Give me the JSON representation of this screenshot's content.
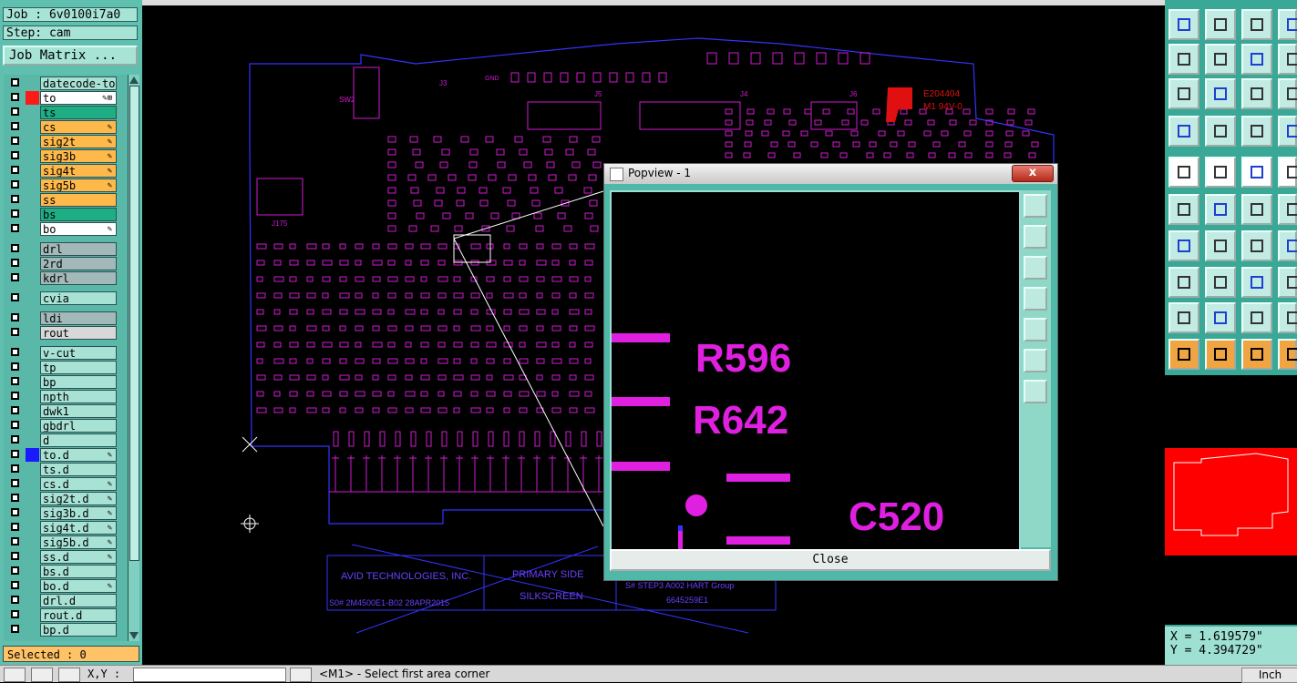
{
  "job": {
    "job_label": "Job : 6v0100i7a0",
    "step_label": "Step: cam",
    "matrix_button": "Job Matrix ..."
  },
  "layers": [
    {
      "name": "datecode-to",
      "color": "#a8e2d4",
      "swatch": "",
      "edit": ""
    },
    {
      "name": "to",
      "color": "#ffffff",
      "swatch": "#ff1a1a",
      "edit": "✎⊞"
    },
    {
      "name": "ts",
      "color": "#1fae83",
      "swatch": "",
      "edit": ""
    },
    {
      "name": "cs",
      "color": "#ffb94a",
      "swatch": "",
      "edit": "✎"
    },
    {
      "name": "sig2t",
      "color": "#ffb94a",
      "swatch": "",
      "edit": "✎"
    },
    {
      "name": "sig3b",
      "color": "#ffb94a",
      "swatch": "",
      "edit": "✎"
    },
    {
      "name": "sig4t",
      "color": "#ffb94a",
      "swatch": "",
      "edit": "✎"
    },
    {
      "name": "sig5b",
      "color": "#ffb94a",
      "swatch": "",
      "edit": "✎"
    },
    {
      "name": "ss",
      "color": "#ffb94a",
      "swatch": "",
      "edit": ""
    },
    {
      "name": "bs",
      "color": "#1fae83",
      "swatch": "",
      "edit": ""
    },
    {
      "name": "bo",
      "color": "#ffffff",
      "swatch": "",
      "edit": "✎"
    },
    {
      "name": "drl",
      "color": "#a3b8b8",
      "swatch": "",
      "edit": ""
    },
    {
      "name": "2rd",
      "color": "#a3b8b8",
      "swatch": "",
      "edit": ""
    },
    {
      "name": "kdrl",
      "color": "#a3b8b8",
      "swatch": "",
      "edit": ""
    },
    {
      "name": "cvia",
      "color": "#a8e2d4",
      "swatch": "",
      "edit": ""
    },
    {
      "name": "ldi",
      "color": "#a3b8b8",
      "swatch": "",
      "edit": ""
    },
    {
      "name": "rout",
      "color": "#d8d8d8",
      "swatch": "",
      "edit": ""
    },
    {
      "name": "v-cut",
      "color": "#a8e2d4",
      "swatch": "",
      "edit": ""
    },
    {
      "name": "tp",
      "color": "#a8e2d4",
      "swatch": "",
      "edit": ""
    },
    {
      "name": "bp",
      "color": "#a8e2d4",
      "swatch": "",
      "edit": ""
    },
    {
      "name": "npth",
      "color": "#a8e2d4",
      "swatch": "",
      "edit": ""
    },
    {
      "name": "dwk1",
      "color": "#a8e2d4",
      "swatch": "",
      "edit": ""
    },
    {
      "name": "gbdrl",
      "color": "#a8e2d4",
      "swatch": "",
      "edit": ""
    },
    {
      "name": "d",
      "color": "#a8e2d4",
      "swatch": "",
      "edit": ""
    },
    {
      "name": "to.d",
      "color": "#a8e2d4",
      "swatch": "#1a1aff",
      "edit": "✎"
    },
    {
      "name": "ts.d",
      "color": "#a8e2d4",
      "swatch": "",
      "edit": ""
    },
    {
      "name": "cs.d",
      "color": "#a8e2d4",
      "swatch": "",
      "edit": "✎"
    },
    {
      "name": "sig2t.d",
      "color": "#a8e2d4",
      "swatch": "",
      "edit": "✎"
    },
    {
      "name": "sig3b.d",
      "color": "#a8e2d4",
      "swatch": "",
      "edit": "✎"
    },
    {
      "name": "sig4t.d",
      "color": "#a8e2d4",
      "swatch": "",
      "edit": "✎"
    },
    {
      "name": "sig5b.d",
      "color": "#a8e2d4",
      "swatch": "",
      "edit": "✎"
    },
    {
      "name": "ss.d",
      "color": "#a8e2d4",
      "swatch": "",
      "edit": "✎"
    },
    {
      "name": "bs.d",
      "color": "#a8e2d4",
      "swatch": "",
      "edit": ""
    },
    {
      "name": "bo.d",
      "color": "#a8e2d4",
      "swatch": "",
      "edit": "✎"
    },
    {
      "name": "drl.d",
      "color": "#a8e2d4",
      "swatch": "",
      "edit": ""
    },
    {
      "name": "rout.d",
      "color": "#a8e2d4",
      "swatch": "",
      "edit": ""
    },
    {
      "name": "bp.d",
      "color": "#a8e2d4",
      "swatch": "",
      "edit": ""
    }
  ],
  "selected_text": "Selected : 0",
  "popview": {
    "title": "Popview - 1",
    "close_x": "x",
    "close_button": "Close",
    "labels": [
      "R596",
      "R642",
      "C520"
    ]
  },
  "board_text": {
    "title_block": [
      "AVID TECHNOLOGIES, INC.",
      "PRIMARY SIDE",
      "SILKSCREEN",
      "S0# 2M4500E1-B02 28APR2015",
      "S# STEP3 A002 HART Group",
      "6645259E1"
    ],
    "ul_mark": [
      "E204404",
      "M1 94V-0"
    ],
    "refdes": [
      "J3",
      "SW2",
      "J5",
      "J4",
      "J6",
      "J175",
      "GND"
    ]
  },
  "coords": {
    "x": "X = 1.619579\"",
    "y": "Y = 4.394729\""
  },
  "bottom": {
    "xy_label": "X,Y :",
    "prompt": "<M1> - Select first area corner",
    "unit": "Inch"
  },
  "toolbar_icons": [
    "layer-up-icon",
    "layer-down-icon",
    "home-icon",
    "help-icon",
    "zoom-previous-icon",
    "zoom-next-icon",
    "undo-icon",
    "redo-icon",
    "zoom-fit-icon",
    "zoom-center-icon",
    "zoom-one-to-one-icon",
    "query-icon",
    "settings-icon",
    "grid-icon",
    "snap-icon",
    "snap-alt-icon",
    "measure-icon",
    "draw-line-icon",
    "ruler-icon",
    "circle-icon",
    "network-icon",
    "cross-icon",
    "connect-icon",
    "step-icon",
    "angle-icon",
    "diagonal-icon",
    "arc-icon",
    "bracket-icon",
    "pad-icon",
    "line-select-icon",
    "dimension-icon",
    "via-icon",
    "angle-tool-icon",
    "triangle-icon",
    "triangle-filled-icon",
    "triangle-outline-icon",
    "pointer-icon",
    "pointer-box-icon",
    "pointer-alt-icon",
    "step-line-icon"
  ],
  "colors": {
    "silkscreen": "#e020e0",
    "outline": "#2020ff",
    "panel": "#60c0b0",
    "overview_fill": "#ff0000"
  }
}
